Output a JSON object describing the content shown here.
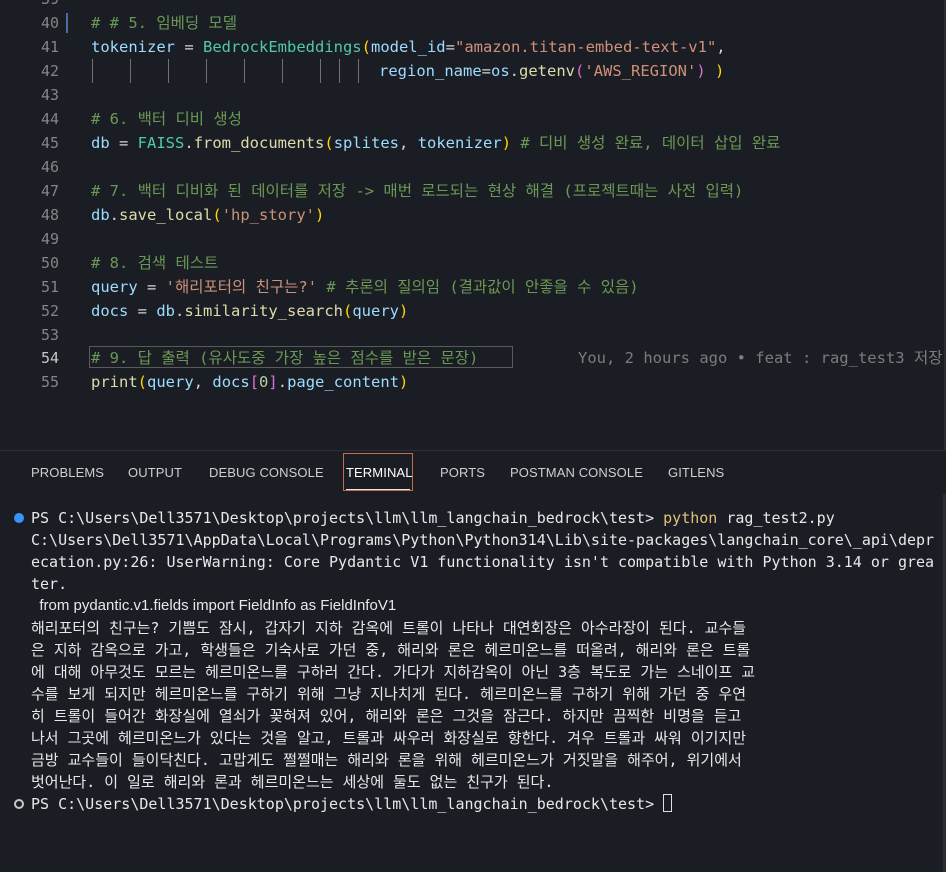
{
  "editor": {
    "lines": [
      {
        "n": "40",
        "text": "# # 5. 임베딩 모델"
      },
      {
        "n": "41",
        "a": "tokenizer",
        "b": " = ",
        "c": "BedrockEmbeddings",
        "d": "(",
        "e": "model_id",
        "f": "=",
        "g": "\"amazon.titan-embed-text-v1\"",
        "h": ","
      },
      {
        "n": "42",
        "a": "region_name",
        "b": "=",
        "c": "os",
        "d": ".",
        "e": "getenv",
        "f": "(",
        "g": "'AWS_REGION'",
        "h": ")",
        "i": " )"
      },
      {
        "n": "43"
      },
      {
        "n": "44",
        "text": "# 6. 백터 디비 생성"
      },
      {
        "n": "45",
        "a": "db",
        "b": " = ",
        "c": "FAISS",
        "d": ".",
        "e": "from_documents",
        "f": "(",
        "g": "splites",
        "h": ", ",
        "i": "tokenizer",
        "j": ")",
        "k": " # 디비 생성 완료, 데이터 삽입 완료"
      },
      {
        "n": "46"
      },
      {
        "n": "47",
        "text": "# 7. 백터 디비화 된 데이터를 저장 -> 매번 로드되는 현상 해결 (프로젝트때는 사전 입력)"
      },
      {
        "n": "48",
        "a": "db",
        "b": ".",
        "c": "save_local",
        "d": "(",
        "e": "'hp_story'",
        "f": ")"
      },
      {
        "n": "49"
      },
      {
        "n": "50",
        "text": "# 8. 검색 테스트"
      },
      {
        "n": "51",
        "a": "query",
        "b": " = ",
        "c": "'해리포터의 친구는?'",
        "d": " # 추론의 질의임 (결과값이 안좋을 수 있음)"
      },
      {
        "n": "52",
        "a": "docs",
        "b": " = ",
        "c": "db",
        "d": ".",
        "e": "similarity_search",
        "f": "(",
        "g": "query",
        "h": ")"
      },
      {
        "n": "53"
      },
      {
        "n": "54",
        "text": "# 9. 답 출력 (유사도중 가장 높은 점수를 받은 문장)",
        "blame": "You, 2 hours ago • feat : rag_test3 저장"
      },
      {
        "n": "55",
        "a": "print",
        "b": "(",
        "c": "query",
        "d": ", ",
        "e": "docs",
        "f": "[",
        "g": "0",
        "h": "]",
        "i": ".",
        "j": "page_content",
        "k": ")"
      }
    ]
  },
  "panel": {
    "tabs": [
      "PROBLEMS",
      "OUTPUT",
      "DEBUG CONSOLE",
      "TERMINAL",
      "PORTS",
      "POSTMAN CONSOLE",
      "GITLENS"
    ],
    "active_tab": "TERMINAL"
  },
  "terminal": {
    "prompt1": "PS C:\\Users\\Dell3571\\Desktop\\projects\\llm\\llm_langchain_bedrock\\test> ",
    "cmd_python": "python",
    "cmd_args": " rag_test2.py",
    "warn1": "C:\\Users\\Dell3571\\AppData\\Local\\Programs\\Python\\Python314\\Lib\\site-packages\\langchain_core\\_api\\depr",
    "warn2": "ecation.py:26: UserWarning: Core Pydantic V1 functionality isn't compatible with Python 3.14 or grea",
    "warn3": "ter.",
    "warn4": "  from pydantic.v1.fields import FieldInfo as FieldInfoV1",
    "out": [
      "해리포터의 친구는? 기쁨도 잠시, 갑자기 지하 감옥에 트롤이 나타나 대연회장은 아수라장이 된다. 교수들",
      "은 지하 감옥으로 가고, 학생들은 기숙사로 가던 중, 해리와 론은 헤르미온느를 떠올려, 해리와 론은 트롤",
      "에 대해 아무것도 모르는 헤르미온느를 구하러 간다. 가다가 지하감옥이 아닌 3층 복도로 가는 스네이프 교",
      "수를 보게 되지만 헤르미온느를 구하기 위해 그냥 지나치게 된다. 헤르미온느를 구하기 위해 가던 중 우연",
      "히 트롤이 들어간 화장실에 열쇠가 꽂혀져 있어, 해리와 론은 그것을 잠근다. 하지만 끔찍한 비명을 듣고",
      "나서 그곳에 헤르미온느가 있다는 것을 알고, 트롤과 싸우러 화장실로 향한다. 겨우 트롤과 싸워 이기지만",
      "금방 교수들이 들이닥친다. 고맙게도 쩔쩔매는 해리와 론을 위해 헤르미온느가 거짓말을 해주어, 위기에서",
      "벗어난다. 이 일로 해리와 론과 헤르미온느는 세상에 둘도 없는 친구가 된다."
    ],
    "prompt2": "PS C:\\Users\\Dell3571\\Desktop\\projects\\llm\\llm_langchain_bedrock\\test> "
  }
}
